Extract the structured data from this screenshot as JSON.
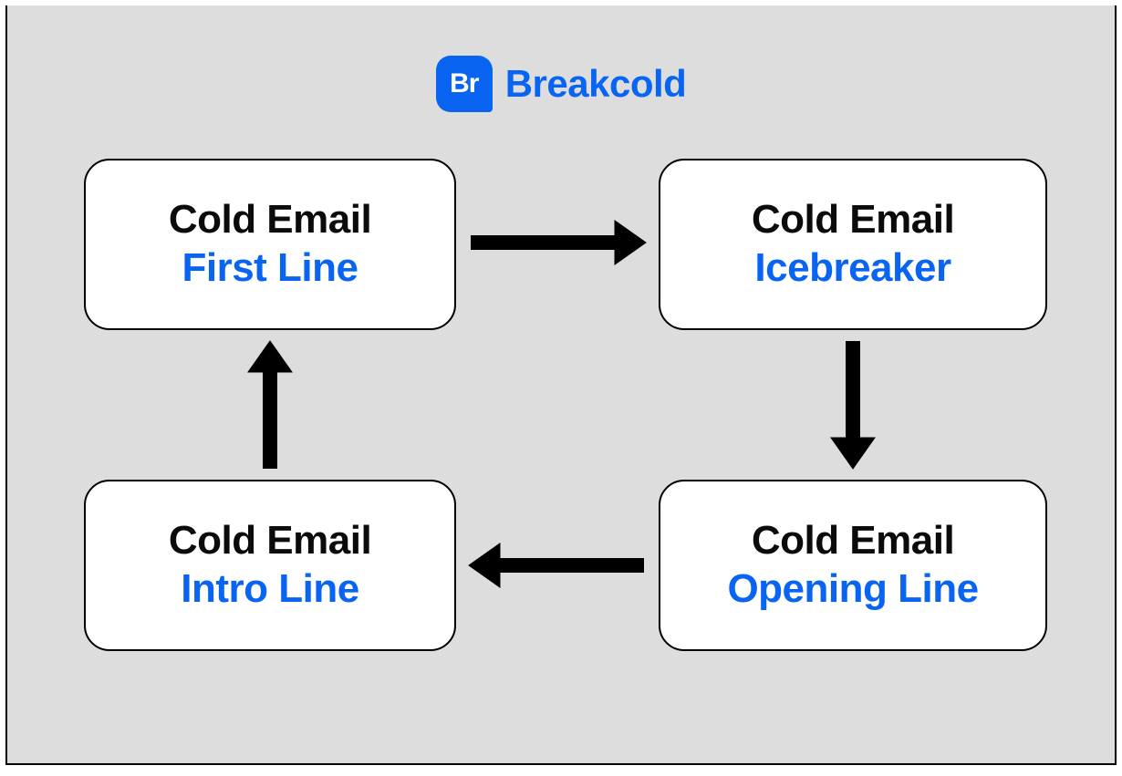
{
  "brand": {
    "mark_text": "Br",
    "name": "Breakcold",
    "color": "#0a64f2"
  },
  "nodes": {
    "top_left": {
      "title": "Cold Email",
      "subtitle": "First Line"
    },
    "top_right": {
      "title": "Cold Email",
      "subtitle": "Icebreaker"
    },
    "bottom_right": {
      "title": "Cold Email",
      "subtitle": "Opening Line"
    },
    "bottom_left": {
      "title": "Cold Email",
      "subtitle": "Intro Line"
    }
  }
}
